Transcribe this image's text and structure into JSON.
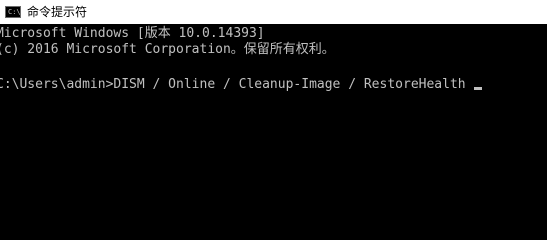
{
  "window": {
    "title": "命令提示符",
    "icon": "cmd-icon",
    "icon_glyph": "C:\\",
    "colors": {
      "titlebar": "#ffffff",
      "console_bg": "#000000",
      "console_text": "#c0c0c0"
    }
  },
  "console": {
    "lines": [
      "Microsoft Windows [版本 10.0.14393]",
      "(c) 2016 Microsoft Corporation。保留所有权利。",
      "",
      "C:\\Users\\admin>DISM / Online / Cleanup-Image / RestoreHealth"
    ]
  }
}
